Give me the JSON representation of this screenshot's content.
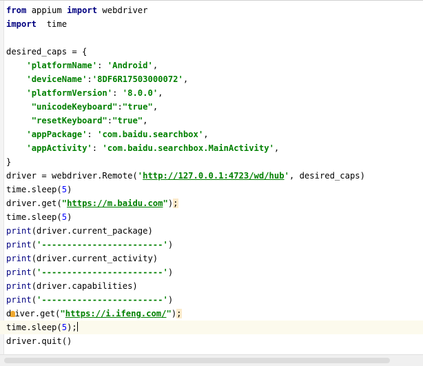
{
  "code": {
    "l1": {
      "kw1": "from",
      "t1": " appium ",
      "kw2": "import",
      "t2": " webdriver"
    },
    "l2": {
      "kw": "import",
      "t": "  time"
    },
    "l4": {
      "t": "desired_caps = {"
    },
    "l5": {
      "i": "    ",
      "k": "'platformName'",
      "s": ": ",
      "v": "'Android'",
      "e": ","
    },
    "l6": {
      "i": "    ",
      "k": "'deviceName'",
      "s": ":",
      "v": "'8DF6R17503000072'",
      "e": ","
    },
    "l7": {
      "i": "    ",
      "k": "'platformVersion'",
      "s": ": ",
      "v": "'8.0.0'",
      "e": ","
    },
    "l8": {
      "i": "     ",
      "k": "\"unicodeKeyboard\"",
      "s": ":",
      "v": "\"true\"",
      "e": ","
    },
    "l9": {
      "i": "     ",
      "k": "\"resetKeyboard\"",
      "s": ":",
      "v": "\"true\"",
      "e": ","
    },
    "l10": {
      "i": "    ",
      "k": "'appPackage'",
      "s": ": ",
      "v": "'com.baidu.searchbox'",
      "e": ","
    },
    "l11": {
      "i": "    ",
      "k": "'appActivity'",
      "s": ": ",
      "v": "'com.baidu.searchbox.MainActivity'",
      "e": ","
    },
    "l12": {
      "t": "}"
    },
    "l13": {
      "a": "driver = webdriver.Remote(",
      "q1": "'",
      "url": "http://127.0.0.1:4723/wd/hub",
      "q2": "'",
      "b": ", desired_caps)"
    },
    "l14": {
      "a": "time.sleep(",
      "n": "5",
      "b": ")"
    },
    "l15": {
      "a": "driver.get(",
      "q1": "\"",
      "url": "https://m.baidu.com",
      "q2": "\"",
      "b": ")",
      "c": ";"
    },
    "l16": {
      "a": "time.sleep(",
      "n": "5",
      "b": ")"
    },
    "l17": {
      "f": "print",
      "b": "(driver.current_package)"
    },
    "l18": {
      "f": "print",
      "o": "(",
      "s": "'------------------------'",
      "c": ")"
    },
    "l19": {
      "f": "print",
      "b": "(driver.current_activity)"
    },
    "l20": {
      "f": "print",
      "o": "(",
      "s": "'------------------------'",
      "c": ")"
    },
    "l21": {
      "f": "print",
      "b": "(driver.capabilities)"
    },
    "l22": {
      "f": "print",
      "o": "(",
      "s": "'------------------------'",
      "c": ")"
    },
    "l23": {
      "a1": "d",
      "a2": "iver.get(",
      "q1": "\"",
      "url": "https://i.ifeng.com/",
      "q2": "\"",
      "b": ")",
      "c": ";"
    },
    "l24": {
      "a": "time.sleep(",
      "n": "5",
      "b": ");"
    },
    "l25": {
      "t": "driver.quit()"
    }
  },
  "icons": {
    "intention": "lightbulb-icon"
  },
  "colors": {
    "keyword": "#000080",
    "string": "#008000",
    "number": "#0000ff",
    "current_line": "#fcfaed"
  }
}
